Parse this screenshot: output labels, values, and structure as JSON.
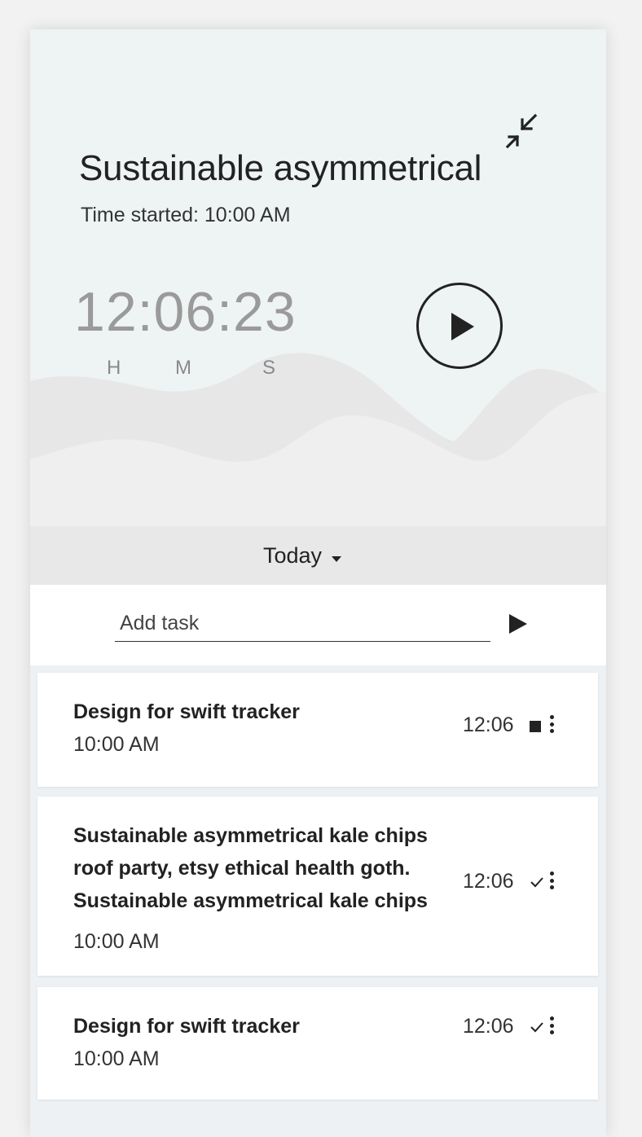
{
  "timer": {
    "title": "Sustainable asymmetrical",
    "started": "Time started: 10:00 AM",
    "clock": "12:06:23",
    "units": [
      "H",
      "M",
      "S"
    ],
    "minimize_icon": "minimize-arrows-icon",
    "play_icon": "play-icon"
  },
  "filter": {
    "label": "Today",
    "icon": "caret-down-icon"
  },
  "add_task": {
    "placeholder": "Add task",
    "value": "",
    "send_icon": "send-icon"
  },
  "tasks": [
    {
      "name": "Design for swift tracker",
      "time": "10:00 AM",
      "duration": "12:06",
      "status": "running",
      "status_icon": "stop-icon"
    },
    {
      "name": "Sustainable asymmetrical kale chips roof party, etsy ethical health goth. Sustainable asymmetrical kale chips",
      "time": "10:00 AM",
      "duration": "12:06",
      "status": "completed",
      "status_icon": "check-icon"
    },
    {
      "name": "Design for swift tracker",
      "time": "10:00 AM",
      "duration": "12:06",
      "status": "completed",
      "status_icon": "check-icon"
    }
  ],
  "colors": {
    "hero_background": "#eef3f3",
    "wave": "#e6e6e6",
    "text": "#222222",
    "clock_text": "#9a9a9a",
    "filter_bar": "#e8e8e8",
    "list_background": "#edf1f4"
  }
}
